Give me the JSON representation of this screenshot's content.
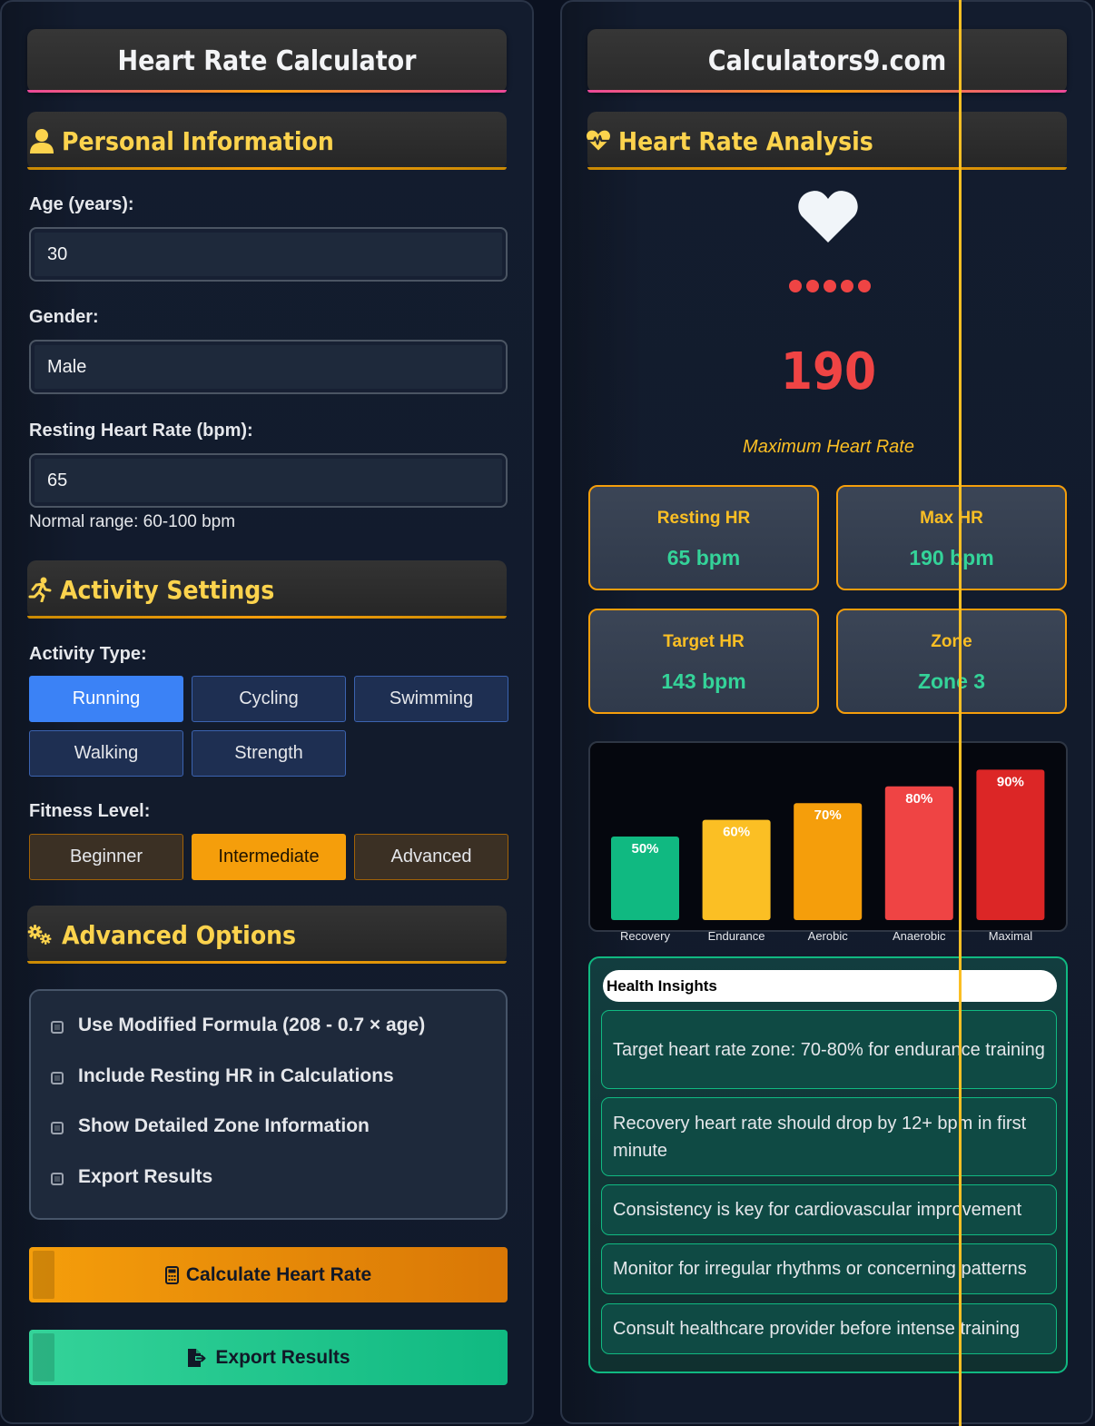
{
  "left": {
    "title": "Heart Rate Calculator",
    "personal": {
      "heading": "Personal Information",
      "age_label": "Age (years):",
      "age_value": "30",
      "gender_label": "Gender:",
      "gender_value": "Male",
      "resting_label": "Resting Heart Rate (bpm):",
      "resting_value": "65",
      "resting_hint": "Normal range: 60-100 bpm"
    },
    "activity": {
      "heading": "Activity Settings",
      "type_label": "Activity Type:",
      "types": [
        "Running",
        "Cycling",
        "Swimming",
        "Walking",
        "Strength"
      ],
      "selected_type": "Running",
      "fitness_label": "Fitness Level:",
      "levels": [
        "Beginner",
        "Intermediate",
        "Advanced"
      ],
      "selected_level": "Intermediate"
    },
    "advanced": {
      "heading": "Advanced Options",
      "options": [
        "Use Modified Formula (208 - 0.7 × age)",
        "Include Resting HR in Calculations",
        "Show Detailed Zone Information",
        "Export Results"
      ]
    },
    "calculate_label": "Calculate Heart Rate",
    "export_label": "Export Results"
  },
  "right": {
    "title": "Calculators9.com",
    "analysis_heading": "Heart Rate Analysis",
    "max_value": "190",
    "max_caption": "Maximum Heart Rate",
    "stats": [
      {
        "label": "Resting HR",
        "value": "65 bpm"
      },
      {
        "label": "Max HR",
        "value": "190 bpm"
      },
      {
        "label": "Target HR",
        "value": "143 bpm"
      },
      {
        "label": "Zone",
        "value": "Zone 3"
      }
    ],
    "insights_title": "Health Insights",
    "insights": [
      "Target heart rate zone: 70-80% for endurance training",
      "Recovery heart rate should drop by 12+ bpm in first minute",
      "Consistency is key for cardiovascular improvement",
      "Monitor for irregular rhythms or concerning patterns",
      "Consult healthcare provider before intense training"
    ]
  },
  "colors": {
    "accent_orange": "#f59e0b",
    "accent_blue": "#3b82f6",
    "accent_green": "#10b981",
    "accent_red": "#ef4444"
  },
  "chart_data": {
    "type": "bar",
    "categories": [
      "Recovery",
      "Endurance",
      "Aerobic",
      "Anaerobic",
      "Maximal"
    ],
    "values": [
      50,
      60,
      70,
      80,
      90
    ],
    "value_labels": [
      "50%",
      "60%",
      "70%",
      "80%",
      "90%"
    ],
    "colors": [
      "#10b981",
      "#fbbf24",
      "#f59e0b",
      "#ef4444",
      "#dc2626"
    ],
    "ylim": [
      0,
      100
    ],
    "grid": false,
    "legend": "none"
  }
}
